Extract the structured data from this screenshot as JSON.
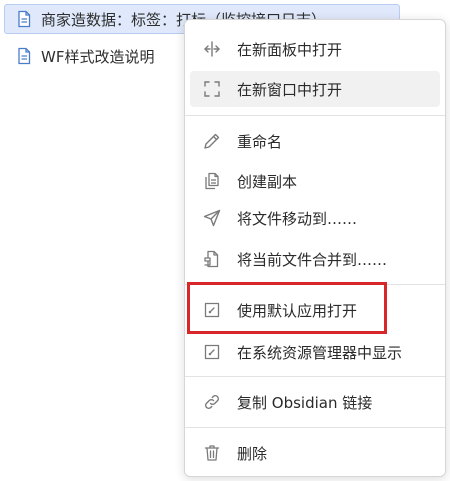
{
  "files": [
    {
      "name": "商家造数据：标签：打标（监控接口日志）",
      "icon": "file-icon",
      "active": true
    },
    {
      "name": "WF样式改造说明",
      "icon": "file-icon",
      "active": false
    }
  ],
  "menu": {
    "open_new_pane": {
      "label": "在新面板中打开",
      "icon": "split-pane-icon"
    },
    "open_new_window": {
      "label": "在新窗口中打开",
      "icon": "window-maximize-icon"
    },
    "rename": {
      "label": "重命名",
      "icon": "pencil-icon"
    },
    "duplicate": {
      "label": "创建副本",
      "icon": "copy-icon"
    },
    "move_file": {
      "label": "将文件移动到……",
      "icon": "send-icon"
    },
    "merge_file": {
      "label": "将当前文件合并到……",
      "icon": "merge-icon"
    },
    "open_default_app": {
      "label": "使用默认应用打开",
      "icon": "external-open-icon"
    },
    "show_in_explorer": {
      "label": "在系统资源管理器中显示",
      "icon": "external-open-icon"
    },
    "copy_link": {
      "label": "复制 Obsidian 链接",
      "icon": "link-icon"
    },
    "delete": {
      "label": "删除",
      "icon": "trash-icon"
    }
  },
  "colors": {
    "accent_highlight": "#d8262b",
    "active_file_bg": "#dfe9fb",
    "icon_gray": "#7a7a7a",
    "file_icon_blue": "#4a7cc9"
  }
}
